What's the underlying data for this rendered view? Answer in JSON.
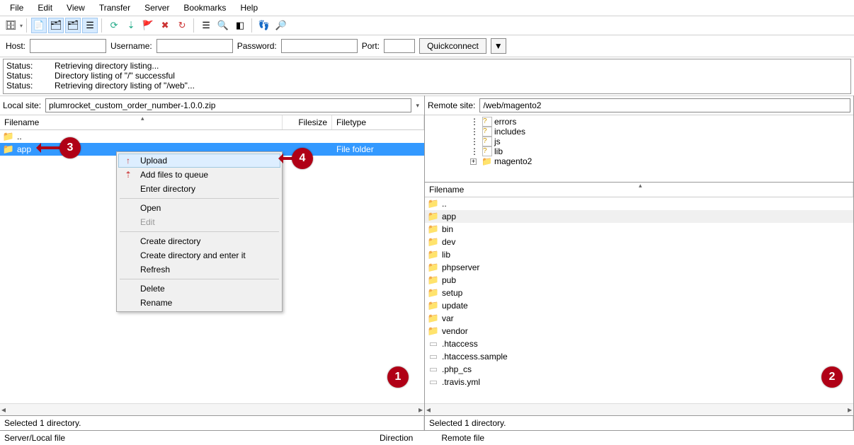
{
  "menu": [
    "File",
    "Edit",
    "View",
    "Transfer",
    "Server",
    "Bookmarks",
    "Help"
  ],
  "quickconnect": {
    "host_label": "Host:",
    "user_label": "Username:",
    "pass_label": "Password:",
    "port_label": "Port:",
    "button": "Quickconnect"
  },
  "log": [
    {
      "s": "Status:",
      "m": "Retrieving directory listing..."
    },
    {
      "s": "Status:",
      "m": "Directory listing of \"/\" successful"
    },
    {
      "s": "Status:",
      "m": "Retrieving directory listing of \"/web\"..."
    }
  ],
  "local": {
    "label": "Local site:",
    "path": "plumrocket_custom_order_number-1.0.0.zip",
    "headers": {
      "fname": "Filename",
      "fsize": "Filesize",
      "ftype": "Filetype"
    },
    "rows": [
      {
        "ic": "folder",
        "name": "..",
        "type": ""
      },
      {
        "ic": "folder",
        "name": "app",
        "type": "File folder",
        "selected": true
      }
    ],
    "status": "Selected 1 directory."
  },
  "remote": {
    "label": "Remote site:",
    "path": "/web/magento2",
    "tree": [
      {
        "ic": "q",
        "name": "errors",
        "ind": 3
      },
      {
        "ic": "q",
        "name": "includes",
        "ind": 3
      },
      {
        "ic": "q",
        "name": "js",
        "ind": 3
      },
      {
        "ic": "q",
        "name": "lib",
        "ind": 3
      },
      {
        "ic": "folder",
        "name": "magento2",
        "ind": 3,
        "exp": true
      }
    ],
    "headers": {
      "fname": "Filename"
    },
    "rows": [
      {
        "ic": "folder",
        "name": ".."
      },
      {
        "ic": "folder",
        "name": "app",
        "hl": true
      },
      {
        "ic": "folder",
        "name": "bin"
      },
      {
        "ic": "folder",
        "name": "dev"
      },
      {
        "ic": "folder",
        "name": "lib"
      },
      {
        "ic": "folder",
        "name": "phpserver"
      },
      {
        "ic": "folder",
        "name": "pub"
      },
      {
        "ic": "folder",
        "name": "setup"
      },
      {
        "ic": "folder",
        "name": "update"
      },
      {
        "ic": "folder",
        "name": "var"
      },
      {
        "ic": "folder",
        "name": "vendor"
      },
      {
        "ic": "file",
        "name": ".htaccess"
      },
      {
        "ic": "file",
        "name": ".htaccess.sample"
      },
      {
        "ic": "file",
        "name": ".php_cs"
      },
      {
        "ic": "file",
        "name": ".travis.yml"
      }
    ],
    "status": "Selected 1 directory."
  },
  "context": {
    "items": [
      {
        "label": "Upload",
        "ic": "up",
        "hl": true
      },
      {
        "label": "Add files to queue",
        "ic": "upq"
      },
      {
        "label": "Enter directory"
      },
      {
        "sep": true
      },
      {
        "label": "Open"
      },
      {
        "label": "Edit",
        "disabled": true
      },
      {
        "sep": true
      },
      {
        "label": "Create directory"
      },
      {
        "label": "Create directory and enter it"
      },
      {
        "label": "Refresh"
      },
      {
        "sep": true
      },
      {
        "label": "Delete"
      },
      {
        "label": "Rename"
      }
    ]
  },
  "transfer": {
    "col1": "Server/Local file",
    "col2": "Direction",
    "col3": "Remote file"
  },
  "annotations": {
    "a1": "1",
    "a2": "2",
    "a3": "3",
    "a4": "4"
  }
}
